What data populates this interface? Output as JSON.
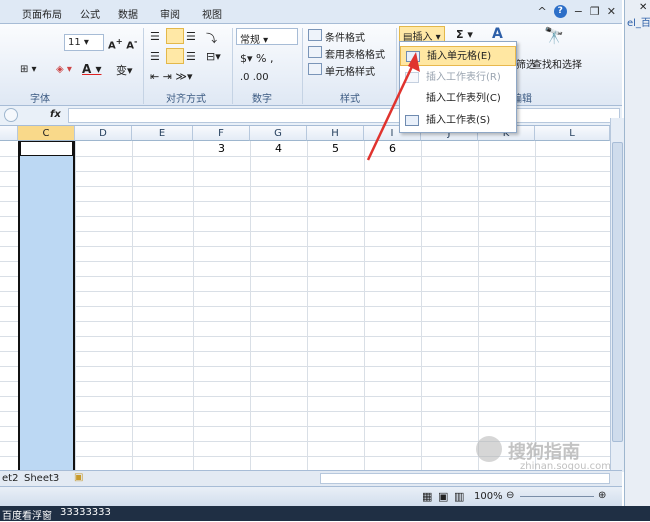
{
  "tabs": [
    "页面布局",
    "公式",
    "数据",
    "审阅",
    "视图"
  ],
  "ribbon": {
    "font_size": "11",
    "font_group": "字体",
    "align_group": "对齐方式",
    "number_format": "常规",
    "number_group": "数字",
    "style_items": [
      "条件格式",
      "套用表格格式",
      "单元格样式"
    ],
    "style_group": "样式",
    "insert_label": "插入",
    "sum_label": "Σ",
    "sort_label": "筛选",
    "find_label": "查找和选择",
    "edit_group": "编辑"
  },
  "insert_menu": {
    "items": [
      {
        "label": "插入单元格(E)",
        "state": "highlighted"
      },
      {
        "label": "插入工作表行(R)",
        "state": "disabled"
      },
      {
        "label": "插入工作表列(C)",
        "state": "normal"
      },
      {
        "label": "插入工作表(S)",
        "state": "normal"
      }
    ]
  },
  "formula_bar": {
    "fx": "fx"
  },
  "columns": [
    "C",
    "D",
    "E",
    "F",
    "G",
    "H",
    "I",
    "J",
    "K",
    "L"
  ],
  "cells": {
    "F": "3",
    "G": "4",
    "H": "5",
    "I": "6"
  },
  "sheets": [
    "et2",
    "Sheet3"
  ],
  "status": {
    "zoom": "100%"
  },
  "taskbar": {
    "app": "百度看浮窗",
    "text": "33333333"
  },
  "watermark": {
    "text": "搜狗指南",
    "url": "zhinan.sogou.com"
  },
  "side_text": "el_百",
  "colors": {
    "accent": "#dfe9f5",
    "selection": "#bcd8f3",
    "highlight": "#ffe7a2",
    "arrow": "#e0332e"
  }
}
